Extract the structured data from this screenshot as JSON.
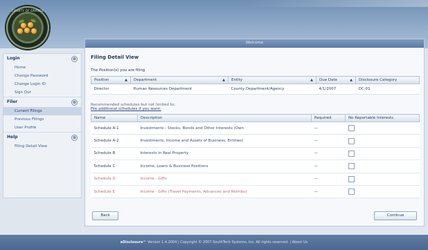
{
  "header": {
    "seal_text": "COUNTY OF ORANGE"
  },
  "sidebar": {
    "sections": [
      {
        "label": "Login",
        "items": [
          "Home",
          "Change Password",
          "Change Login ID",
          "Sign Out"
        ]
      },
      {
        "label": "Filer",
        "items": [
          "Current Filings",
          "Previous Filings",
          "User Profile"
        ]
      },
      {
        "label": "Help",
        "items": [
          "Filing Detail View"
        ]
      }
    ],
    "active_item": "Current Filings"
  },
  "panel": {
    "title": "Welcome",
    "page_title": "Filing Detail View",
    "positions_caption": "The Position(s) you are filing",
    "positions": {
      "columns": [
        "Position",
        "Department",
        "Entity",
        "Due Date",
        "Disclosure Category"
      ],
      "rows": [
        [
          "Director",
          "Human Resources Department",
          "County Department/Agency",
          "4/1/2007",
          "OC-01"
        ]
      ]
    },
    "recommended_caption": "Recommended schedules but not limited to:",
    "additional_caption": "File additional schedules if you want:",
    "schedules": {
      "columns": [
        "Name",
        "Description",
        "Required",
        "No Reportable Interests"
      ],
      "rows": [
        {
          "name": "Schedule A-1",
          "description": "Investments - Stocks, Bonds and Other Interests (Own",
          "required": "—"
        },
        {
          "name": "Schedule A-2",
          "description": "Investments, Income and Assets of Business, Entities)",
          "required": "—"
        },
        {
          "name": "Schedule B",
          "description": "Interests in Real Property",
          "required": "—"
        },
        {
          "name": "Schedule C",
          "description": "Income, Loans & Business Positions",
          "required": "—"
        },
        {
          "name": "Schedule D",
          "description": "Income - Gifts",
          "required": "—"
        },
        {
          "name": "Schedule E",
          "description": "Income - Gifts (Travel Payments, Advances and Reimbu)",
          "required": "—"
        }
      ]
    },
    "back_label": "Back",
    "continue_label": "Continue"
  },
  "footer": {
    "product": "eDisclosure™",
    "version": "Version 1.4.2004",
    "copyright": "Copyright © 2007 SouthTech Systems, Inc. All rights reserved.",
    "about": "About Us"
  },
  "colors": {
    "header_top": "#6f8fb4",
    "panel_title": "#5f7fa9",
    "footer": "#4c6890"
  }
}
